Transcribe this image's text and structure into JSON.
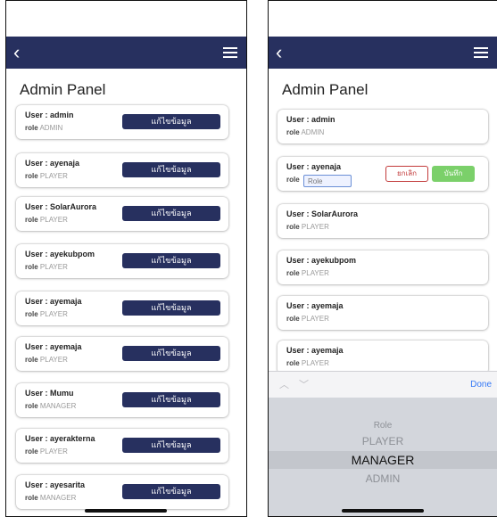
{
  "admin_panel_title": "Admin Panel",
  "navbar": {
    "back_icon": "chevron-left-icon",
    "menu_icon": "hamburger-icon",
    "background": "#27305f"
  },
  "edit_button_label": "แก้ไขข้อมูล",
  "role_label": "role",
  "left_screen": {
    "users": [
      {
        "user": "User : admin",
        "role": "ADMIN"
      },
      {
        "user": "User : ayenaja",
        "role": "PLAYER"
      },
      {
        "user": "User : SolarAurora",
        "role": "PLAYER"
      },
      {
        "user": "User : ayekubpom",
        "role": "PLAYER"
      },
      {
        "user": "User : ayemaja",
        "role": "PLAYER"
      },
      {
        "user": "User : ayemaja",
        "role": "PLAYER"
      },
      {
        "user": "User : Mumu",
        "role": "MANAGER"
      },
      {
        "user": "User : ayerakterna",
        "role": "PLAYER"
      },
      {
        "user": "User : ayesarita",
        "role": "MANAGER"
      }
    ]
  },
  "right_screen": {
    "users": [
      {
        "user": "User : admin",
        "role": "ADMIN"
      },
      {
        "user": "User : ayenaja",
        "role": ""
      },
      {
        "user": "User : SolarAurora",
        "role": "PLAYER"
      },
      {
        "user": "User : ayekubpom",
        "role": "PLAYER"
      },
      {
        "user": "User : ayemaja",
        "role": "PLAYER"
      },
      {
        "user": "User : ayemaja",
        "role": "PLAYER"
      }
    ],
    "editing": {
      "role_placeholder": "Role",
      "cancel_label": "ยกเลิก",
      "save_label": "บันทึก"
    },
    "picker": {
      "done_label": "Done",
      "options": [
        "Role",
        "PLAYER",
        "MANAGER",
        "ADMIN"
      ],
      "selected": "MANAGER"
    }
  }
}
